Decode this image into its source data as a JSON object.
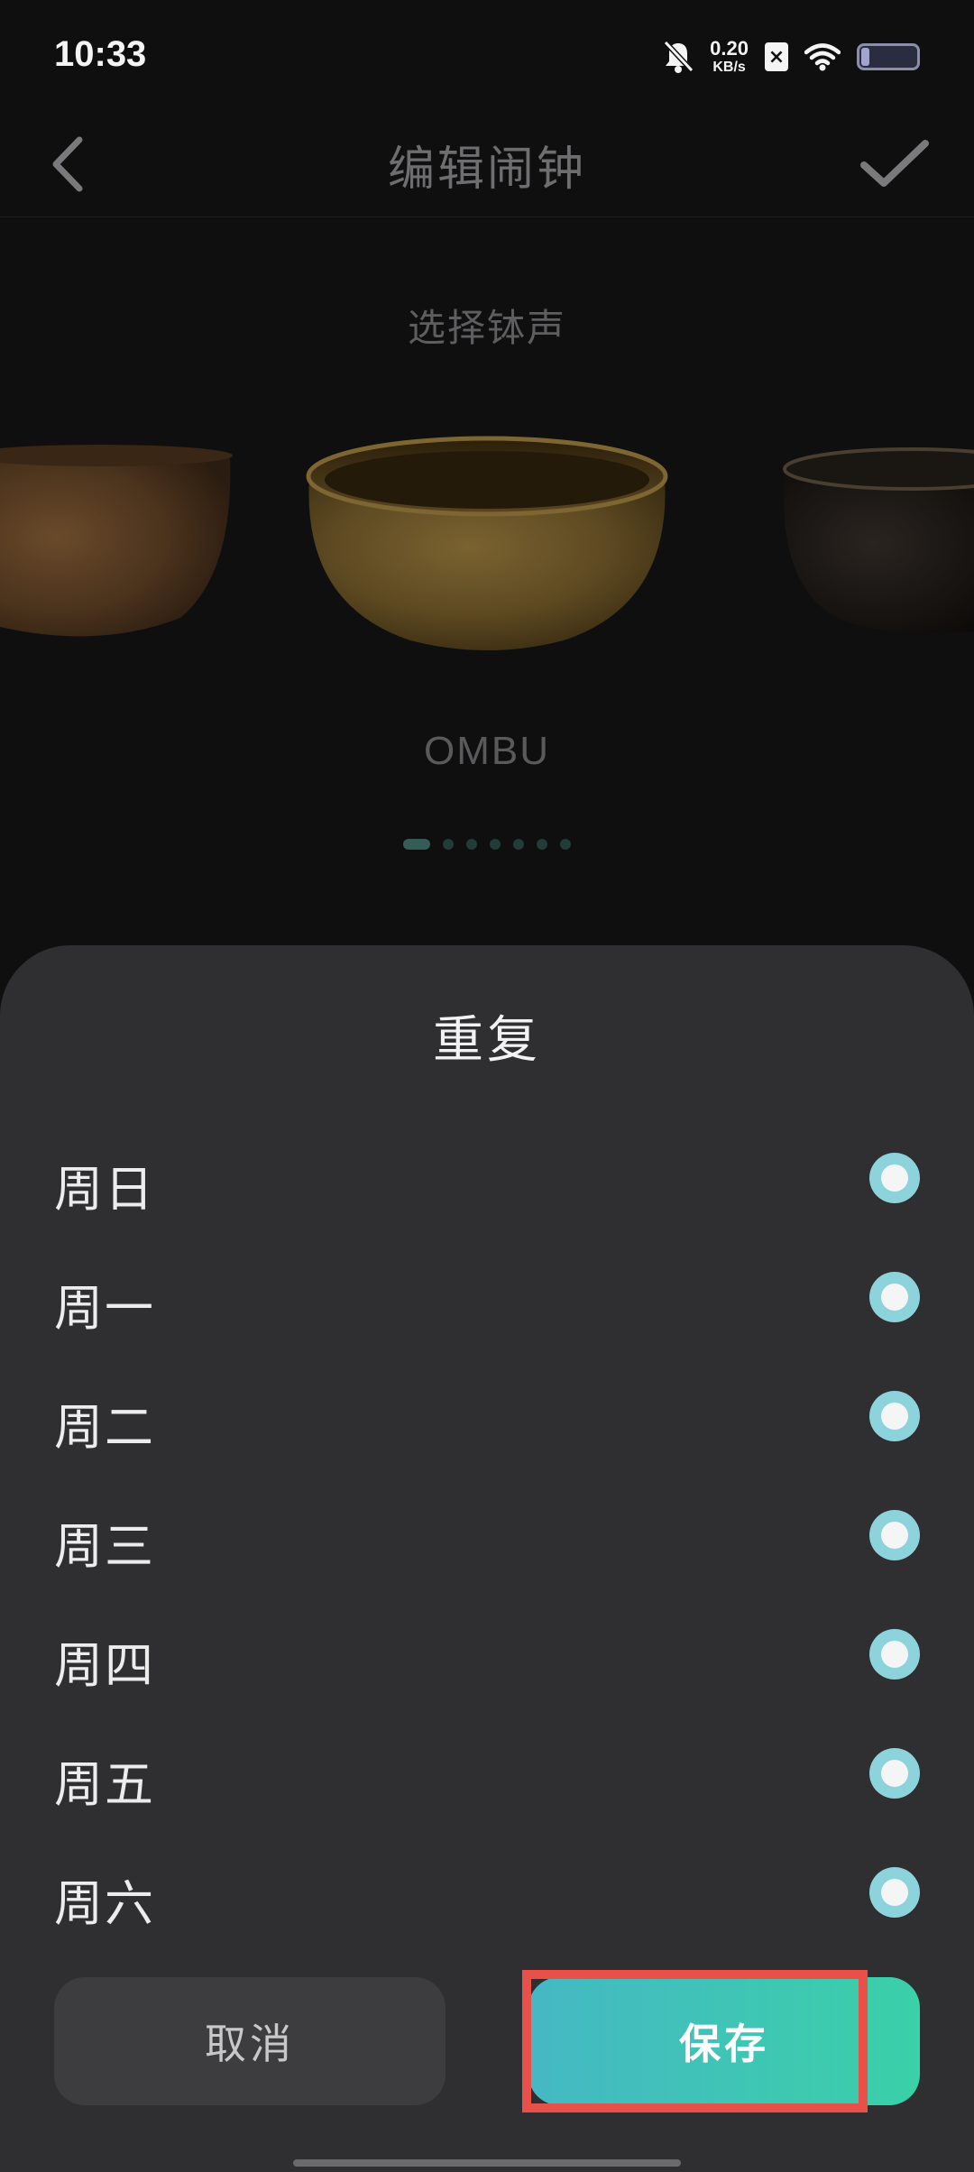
{
  "status_bar": {
    "time": "10:33",
    "net_speed_value": "0.20",
    "net_speed_unit": "KB/s",
    "icons": [
      "bell-off-icon",
      "sim-x-icon",
      "wifi-icon",
      "battery-icon"
    ],
    "battery_level": 0.15
  },
  "header": {
    "title": "编辑闹钟",
    "back_icon": "chevron-left-icon",
    "confirm_icon": "check-icon"
  },
  "sound": {
    "section_title": "选择钵声",
    "selected_name": "OMBU",
    "page_count": 7,
    "current_page": 1
  },
  "repeat_sheet": {
    "title": "重复",
    "days": [
      {
        "label": "周日",
        "selected": true
      },
      {
        "label": "周一",
        "selected": true
      },
      {
        "label": "周二",
        "selected": true
      },
      {
        "label": "周三",
        "selected": true
      },
      {
        "label": "周四",
        "selected": true
      },
      {
        "label": "周五",
        "selected": true
      },
      {
        "label": "周六",
        "selected": true
      }
    ],
    "cancel_label": "取消",
    "save_label": "保存"
  },
  "colors": {
    "accent_start": "#45b8c4",
    "accent_end": "#3ad0a8",
    "radio": "#8dd3dc",
    "highlight": "#e8504a",
    "sheet_bg": "#2f2f31"
  }
}
